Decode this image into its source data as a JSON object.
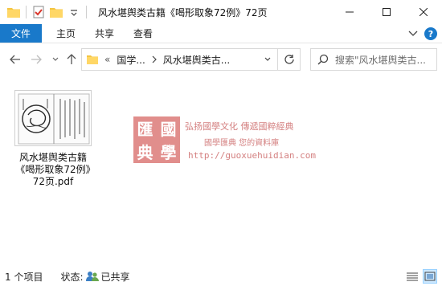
{
  "window": {
    "title": "风水堪舆类古籍《喝形取象72例》72页"
  },
  "ribbon": {
    "tabs": [
      "文件",
      "主页",
      "共享",
      "查看"
    ]
  },
  "address": {
    "prefix": "«",
    "crumbs": [
      "国学...",
      "风水堪舆类古..."
    ]
  },
  "search": {
    "placeholder": "搜索\"风水堪舆类古..."
  },
  "files": [
    {
      "name": "风水堪舆类古籍《喝形取象72例》72页.pdf"
    }
  ],
  "watermark": {
    "seal_chars": [
      "匯",
      "國",
      "典",
      "學"
    ],
    "line1": "弘扬國學文化  傳遞國粹經典",
    "line2": "國學匯典  您的資料庫",
    "url": "http://guoxuehuidian.com"
  },
  "status": {
    "count": "1 个项目",
    "state_label": "状态:",
    "state_value": "已共享"
  },
  "colors": {
    "accent": "#1979ca",
    "folder": "#f4c542",
    "seal": "#c9332f"
  }
}
